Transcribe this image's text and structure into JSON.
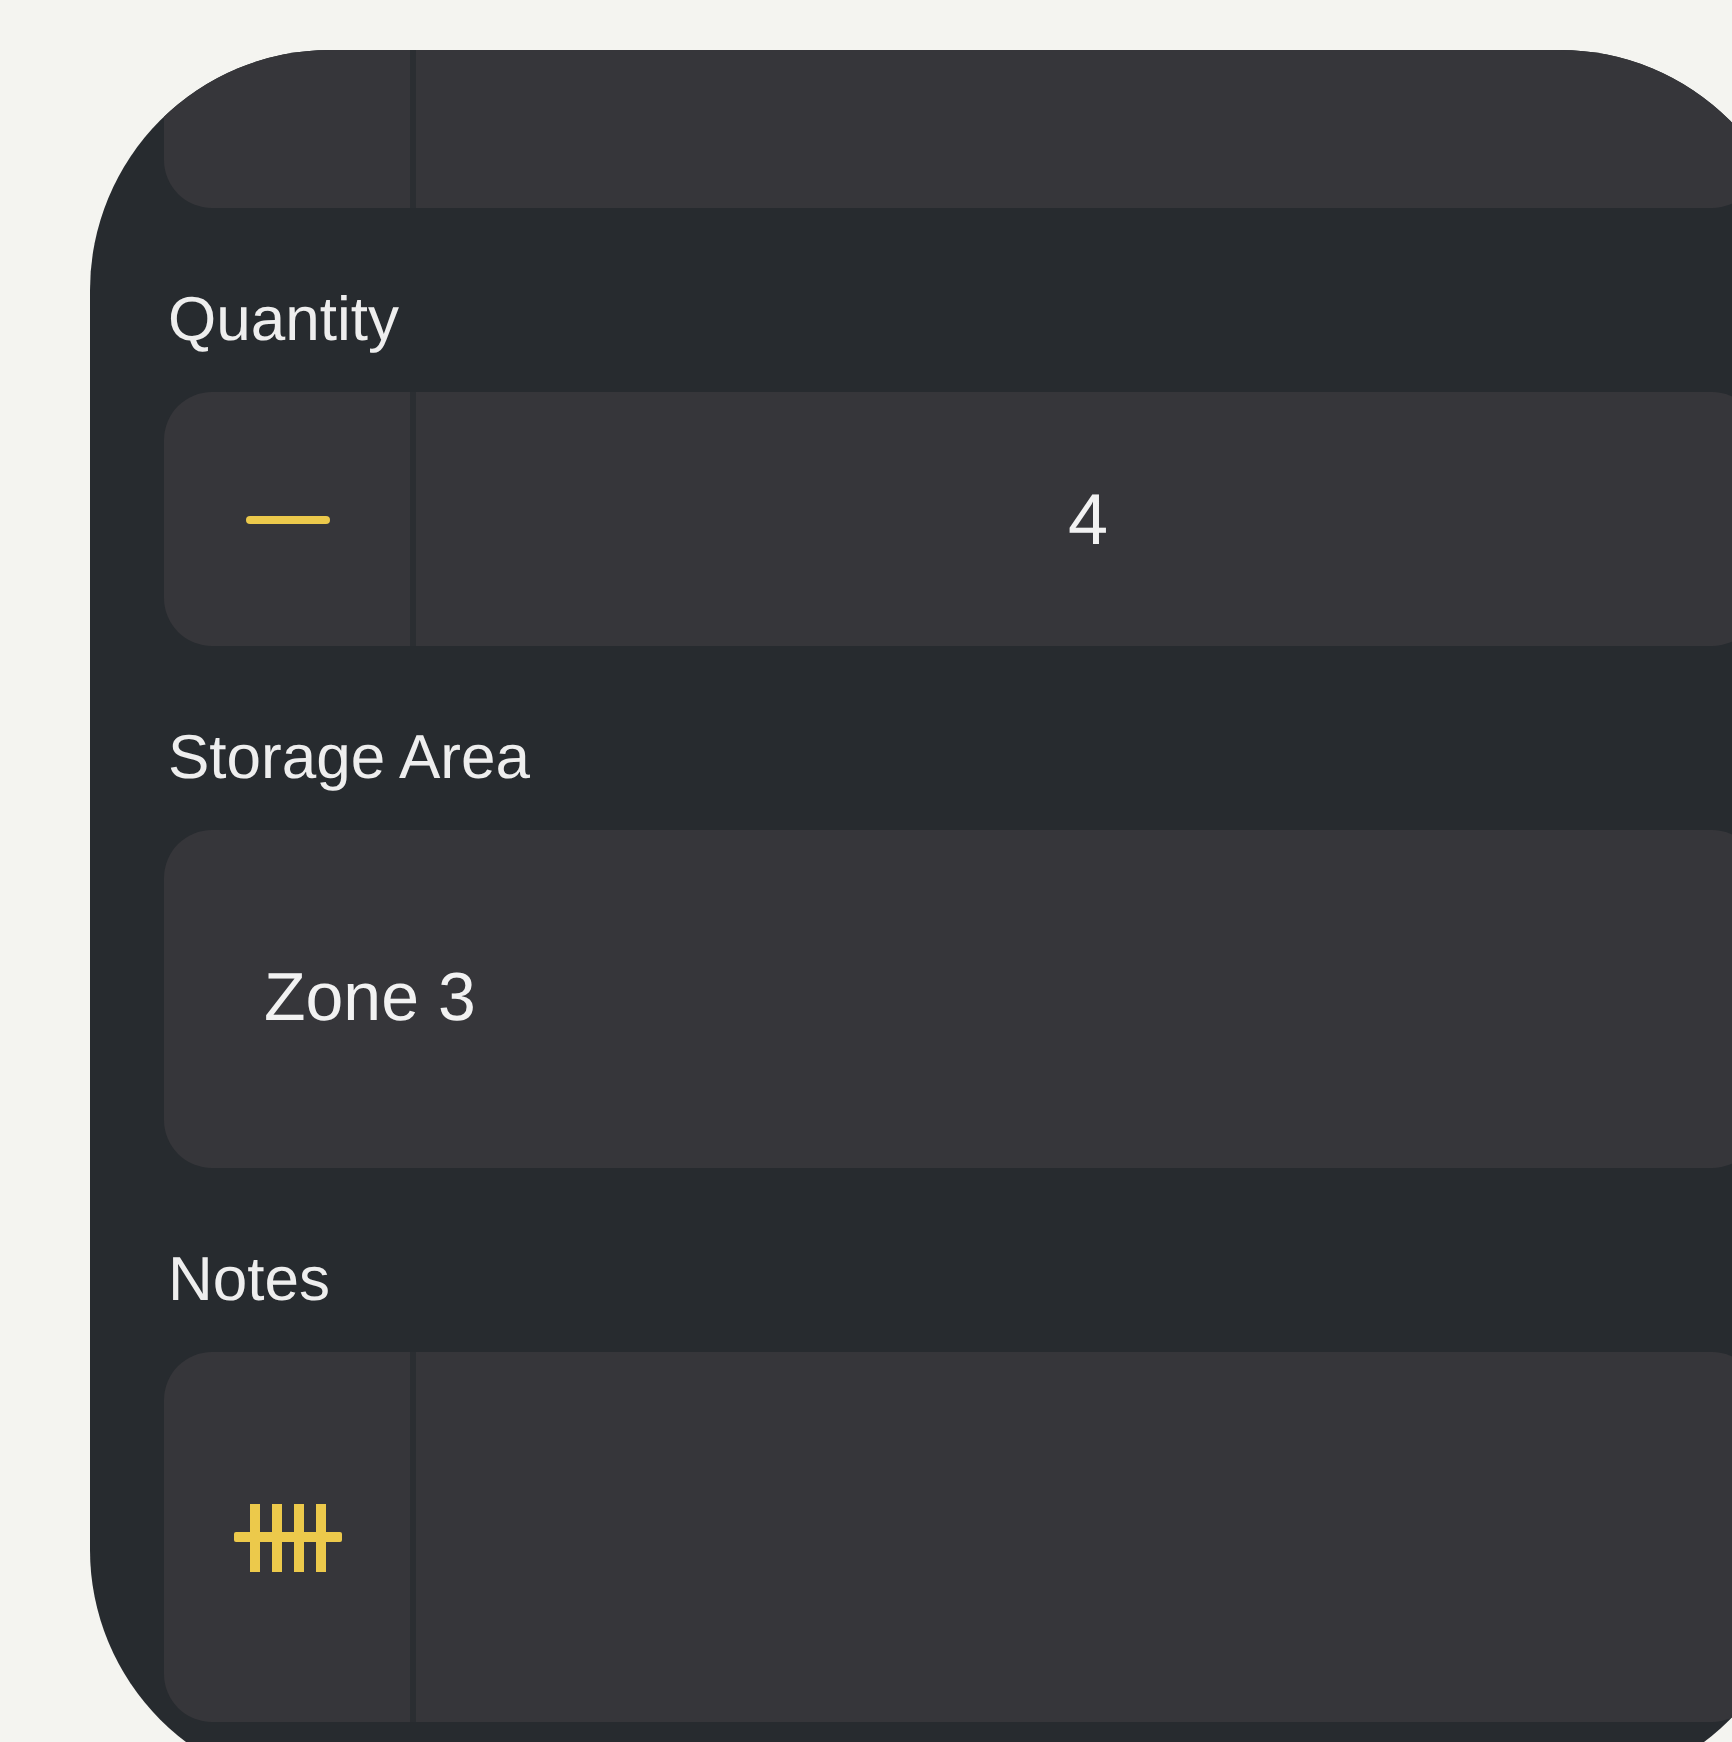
{
  "fields": [
    {
      "kind": "stepper",
      "label": "Quantity",
      "value": "4"
    },
    {
      "kind": "text",
      "label": "Storage Area",
      "value": "Zone 3"
    },
    {
      "kind": "notes",
      "label": "Notes"
    }
  ]
}
